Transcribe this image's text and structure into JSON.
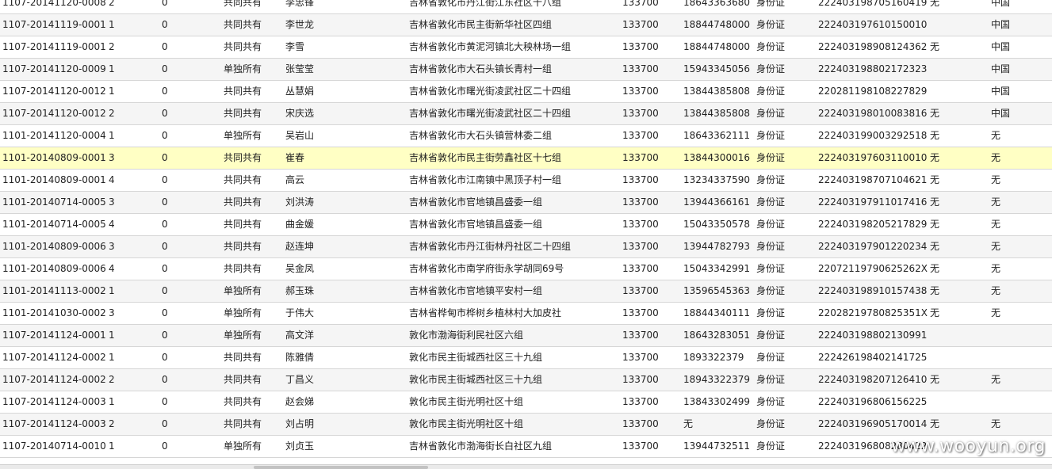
{
  "table": {
    "rows": [
      {
        "id": "1107-20141120-0008",
        "seq": "2",
        "flag": "0",
        "ownership": "共同共有",
        "name": "李忠锋",
        "address": "吉林省敦化市丹江街江东社区十八组",
        "postcode": "133700",
        "phone": "18643363680",
        "id_type": "身份证",
        "id_number": "222403198705160419",
        "col_a": "无",
        "col_b": "中国"
      },
      {
        "id": "1107-20141119-0001",
        "seq": "1",
        "flag": "0",
        "ownership": "共同共有",
        "name": "李世龙",
        "address": "吉林省敦化市民主街新华社区四组",
        "postcode": "133700",
        "phone": "18844748000",
        "id_type": "身份证",
        "id_number": "222403197610150010",
        "col_a": "",
        "col_b": "中国"
      },
      {
        "id": "1107-20141119-0001",
        "seq": "2",
        "flag": "0",
        "ownership": "共同共有",
        "name": "李雪",
        "address": "吉林省敦化市黄泥河镇北大秧林场一组",
        "postcode": "133700",
        "phone": "18844748000",
        "id_type": "身份证",
        "id_number": "222403198908124362",
        "col_a": "无",
        "col_b": "中国"
      },
      {
        "id": "1107-20141120-0009",
        "seq": "1",
        "flag": "0",
        "ownership": "单独所有",
        "name": "张莹莹",
        "address": "吉林省敦化市大石头镇长青村一组",
        "postcode": "133700",
        "phone": "15943345056",
        "id_type": "身份证",
        "id_number": "222403198802172323",
        "col_a": "",
        "col_b": "中国"
      },
      {
        "id": "1107-20141120-0012",
        "seq": "1",
        "flag": "0",
        "ownership": "共同共有",
        "name": "丛慧娟",
        "address": "吉林省敦化市曙光街凌武社区二十四组",
        "postcode": "133700",
        "phone": "13844385808",
        "id_type": "身份证",
        "id_number": "220281198108227829",
        "col_a": "",
        "col_b": "中国"
      },
      {
        "id": "1107-20141120-0012",
        "seq": "2",
        "flag": "0",
        "ownership": "共同共有",
        "name": "宋庆选",
        "address": "吉林省敦化市曙光街凌武社区二十四组",
        "postcode": "133700",
        "phone": "13844385808",
        "id_type": "身份证",
        "id_number": "222403198010083816",
        "col_a": "无",
        "col_b": "中国"
      },
      {
        "id": "1101-20141120-0004",
        "seq": "1",
        "flag": "0",
        "ownership": "单独所有",
        "name": "吴岩山",
        "address": "吉林省敦化市大石头镇营林委二组",
        "postcode": "133700",
        "phone": "18643362111",
        "id_type": "身份证",
        "id_number": "222403199003292518",
        "col_a": "无",
        "col_b": "无"
      },
      {
        "id": "1101-20140809-0001",
        "seq": "3",
        "flag": "0",
        "ownership": "共同共有",
        "name": "崔春",
        "address": "吉林省敦化市民主街劳鑫社区十七组",
        "postcode": "133700",
        "phone": "13844300016",
        "id_type": "身份证",
        "id_number": "222403197603110010",
        "col_a": "无",
        "col_b": "无",
        "highlight": true
      },
      {
        "id": "1101-20140809-0001",
        "seq": "4",
        "flag": "0",
        "ownership": "共同共有",
        "name": "高云",
        "address": "吉林省敦化市江南镇中黑顶子村一组",
        "postcode": "133700",
        "phone": "13234337590",
        "id_type": "身份证",
        "id_number": "222403198707104621",
        "col_a": "无",
        "col_b": "无"
      },
      {
        "id": "1101-20140714-0005",
        "seq": "3",
        "flag": "0",
        "ownership": "共同共有",
        "name": "刘洪涛",
        "address": "吉林省敦化市官地镇昌盛委一组",
        "postcode": "133700",
        "phone": "13944366161",
        "id_type": "身份证",
        "id_number": "222403197911017416",
        "col_a": "无",
        "col_b": "无"
      },
      {
        "id": "1101-20140714-0005",
        "seq": "4",
        "flag": "0",
        "ownership": "共同共有",
        "name": "曲金媛",
        "address": "吉林省敦化市官地镇昌盛委一组",
        "postcode": "133700",
        "phone": "15043350578",
        "id_type": "身份证",
        "id_number": "222403198205217829",
        "col_a": "无",
        "col_b": "无"
      },
      {
        "id": "1101-20140809-0006",
        "seq": "3",
        "flag": "0",
        "ownership": "共同共有",
        "name": "赵连坤",
        "address": "吉林省敦化市丹江街林丹社区二十四组",
        "postcode": "133700",
        "phone": "13944782793",
        "id_type": "身份证",
        "id_number": "222403197901220234",
        "col_a": "无",
        "col_b": "无"
      },
      {
        "id": "1101-20140809-0006",
        "seq": "4",
        "flag": "0",
        "ownership": "共同共有",
        "name": "吴金凤",
        "address": "吉林省敦化市南学府街永学胡同69号",
        "postcode": "133700",
        "phone": "15043342991",
        "id_type": "身份证",
        "id_number": "22072119790625262X",
        "col_a": "无",
        "col_b": "无"
      },
      {
        "id": "1101-20141113-0002",
        "seq": "1",
        "flag": "0",
        "ownership": "单独所有",
        "name": "郝玉珠",
        "address": "吉林省敦化市官地镇平安村一组",
        "postcode": "133700",
        "phone": "13596545363",
        "id_type": "身份证",
        "id_number": "222403198910157438",
        "col_a": "无",
        "col_b": "无"
      },
      {
        "id": "1101-20141030-0002",
        "seq": "3",
        "flag": "0",
        "ownership": "单独所有",
        "name": "于伟大",
        "address": "吉林省桦甸市桦树乡植林村大加皮社",
        "postcode": "133700",
        "phone": "18844340111",
        "id_type": "身份证",
        "id_number": "22028219780825351X",
        "col_a": "无",
        "col_b": "无"
      },
      {
        "id": "1107-20141124-0001",
        "seq": "1",
        "flag": "0",
        "ownership": "单独所有",
        "name": "高文洋",
        "address": "敦化市渤海街利民社区六组",
        "postcode": "133700",
        "phone": "18643283051",
        "id_type": "身份证",
        "id_number": "222403198802130991",
        "col_a": "",
        "col_b": ""
      },
      {
        "id": "1107-20141124-0002",
        "seq": "1",
        "flag": "0",
        "ownership": "共同共有",
        "name": "陈雅倩",
        "address": "敦化市民主街城西社区三十九组",
        "postcode": "133700",
        "phone": "1893322379",
        "id_type": "身份证",
        "id_number": "222426198402141725",
        "col_a": "",
        "col_b": ""
      },
      {
        "id": "1107-20141124-0002",
        "seq": "2",
        "flag": "0",
        "ownership": "共同共有",
        "name": "丁昌义",
        "address": "敦化市民主街城西社区三十九组",
        "postcode": "133700",
        "phone": "18943322379",
        "id_type": "身份证",
        "id_number": "222403198207126410",
        "col_a": "无",
        "col_b": "无"
      },
      {
        "id": "1107-20141124-0003",
        "seq": "1",
        "flag": "0",
        "ownership": "共同共有",
        "name": "赵会娣",
        "address": "敦化市民主街光明社区十组",
        "postcode": "133700",
        "phone": "13843302499",
        "id_type": "身份证",
        "id_number": "222403196806156225",
        "col_a": "",
        "col_b": ""
      },
      {
        "id": "1107-20141124-0003",
        "seq": "2",
        "flag": "0",
        "ownership": "共同共有",
        "name": "刘占明",
        "address": "敦化市民主街光明社区十组",
        "postcode": "133700",
        "phone": "无",
        "id_type": "身份证",
        "id_number": "222403196905170014",
        "col_a": "无",
        "col_b": "无"
      },
      {
        "id": "1107-20140714-0010",
        "seq": "1",
        "flag": "0",
        "ownership": "单独所有",
        "name": "刘贞玉",
        "address": "吉林省敦化市渤海街长白社区九组",
        "postcode": "133700",
        "phone": "13944732511",
        "id_type": "身份证",
        "id_number": "222403196808280422",
        "col_a": "",
        "col_b": ""
      }
    ]
  },
  "watermark": {
    "text": "www.wooyun.org"
  }
}
